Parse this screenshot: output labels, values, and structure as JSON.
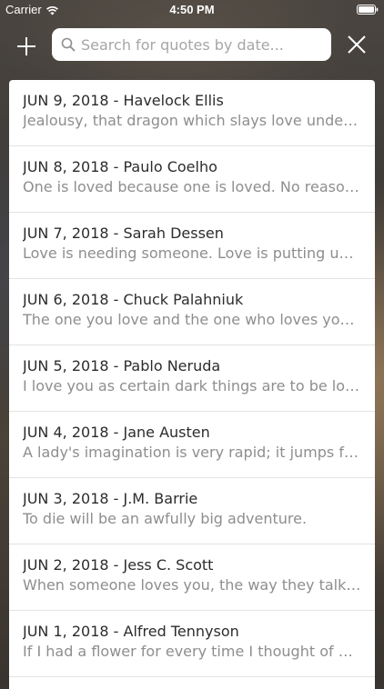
{
  "status_bar": {
    "carrier": "Carrier",
    "time": "4:50 PM"
  },
  "search": {
    "placeholder": "Search for quotes by date..."
  },
  "icons": {
    "add": "plus-icon",
    "search": "magnifier-icon",
    "close": "x-icon",
    "wifi": "wifi-icon",
    "battery": "battery-icon"
  },
  "quotes": [
    {
      "title": "JUN 9, 2018 - Havelock Ellis",
      "quote": "Jealousy, that dragon which slays love under t..."
    },
    {
      "title": "JUN 8, 2018 - Paulo Coelho",
      "quote": "One is loved because one is loved. No reason..."
    },
    {
      "title": "JUN 7, 2018 - Sarah Dessen",
      "quote": "Love is needing someone. Love is putting up..."
    },
    {
      "title": "JUN 6, 2018 - Chuck Palahniuk",
      "quote": "The one you love and the one who loves you..."
    },
    {
      "title": "JUN 5, 2018 - Pablo Neruda",
      "quote": "I love you as certain dark things are to be love..."
    },
    {
      "title": "JUN 4, 2018 - Jane Austen",
      "quote": "A lady's imagination is very rapid; it jumps fro..."
    },
    {
      "title": "JUN 3, 2018 - J.M. Barrie",
      "quote": "To die will be an awfully big adventure."
    },
    {
      "title": "JUN 2, 2018 - Jess C. Scott",
      "quote": "When someone loves you, the way they talk a..."
    },
    {
      "title": "JUN 1, 2018 - Alfred Tennyson",
      "quote": "If I had a flower for every time I thought of yo..."
    }
  ],
  "colors": {
    "title_text": "#2c2c2c",
    "quote_text": "#8e8e8e",
    "separator": "#e3e3e3"
  }
}
